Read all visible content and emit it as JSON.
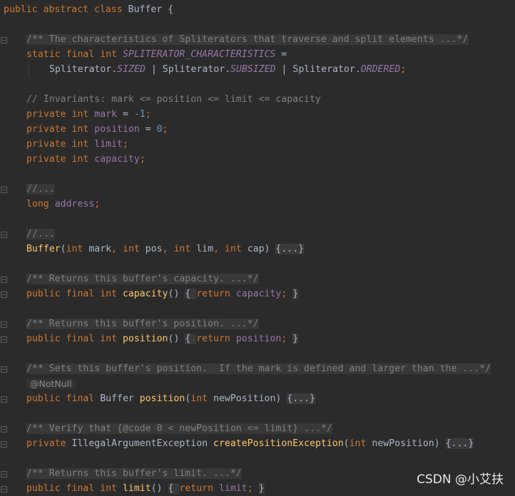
{
  "editor": {
    "colors": {
      "background": "#2b2b2b",
      "keyword": "#cc7832",
      "field": "#9876aa",
      "method": "#ffc66d",
      "number": "#6897bb",
      "comment": "#808080"
    },
    "lines": [
      {
        "fold": false,
        "indent": 0,
        "tokens": [
          [
            "kw",
            "public abstract class "
          ],
          [
            "pl",
            "Buffer {"
          ]
        ]
      },
      {
        "blank": true
      },
      {
        "fold": true,
        "indent": 4,
        "tokens": [
          [
            "doc",
            "/** The characteristics of Spliterators that traverse and split elements ...*/"
          ]
        ]
      },
      {
        "fold": false,
        "indent": 4,
        "tokens": [
          [
            "kw",
            "static final int "
          ],
          [
            "fldi",
            "SPLITERATOR_CHARACTERISTICS"
          ],
          [
            "pl",
            " ="
          ]
        ]
      },
      {
        "fold": false,
        "indent": 8,
        "tokens": [
          [
            "pl",
            "Spliterator."
          ],
          [
            "fldi",
            "SIZED"
          ],
          [
            "pl",
            " | Spliterator."
          ],
          [
            "fldi",
            "SUBSIZED"
          ],
          [
            "pl",
            " | Spliterator."
          ],
          [
            "fldi",
            "ORDERED"
          ],
          [
            "kw",
            ";"
          ]
        ]
      },
      {
        "blank": true
      },
      {
        "fold": false,
        "indent": 4,
        "tokens": [
          [
            "cmt",
            "// Invariants: mark <= position <= limit <= capacity"
          ]
        ]
      },
      {
        "fold": false,
        "indent": 4,
        "tokens": [
          [
            "kw",
            "private int "
          ],
          [
            "fld",
            "mark"
          ],
          [
            "pl",
            " = "
          ],
          [
            "num",
            "-1"
          ],
          [
            "kw",
            ";"
          ]
        ]
      },
      {
        "fold": false,
        "indent": 4,
        "tokens": [
          [
            "kw",
            "private int "
          ],
          [
            "fld",
            "position"
          ],
          [
            "pl",
            " = "
          ],
          [
            "num",
            "0"
          ],
          [
            "kw",
            ";"
          ]
        ]
      },
      {
        "fold": false,
        "indent": 4,
        "tokens": [
          [
            "kw",
            "private int "
          ],
          [
            "fld",
            "limit"
          ],
          [
            "kw",
            ";"
          ]
        ]
      },
      {
        "fold": false,
        "indent": 4,
        "tokens": [
          [
            "kw",
            "private int "
          ],
          [
            "fld",
            "capacity"
          ],
          [
            "kw",
            ";"
          ]
        ]
      },
      {
        "blank": true
      },
      {
        "fold": true,
        "indent": 4,
        "tokens": [
          [
            "doc",
            "//..."
          ]
        ]
      },
      {
        "fold": false,
        "indent": 4,
        "tokens": [
          [
            "kw",
            "long "
          ],
          [
            "fld",
            "address"
          ],
          [
            "kw",
            ";"
          ]
        ]
      },
      {
        "blank": true
      },
      {
        "fold": true,
        "indent": 4,
        "tokens": [
          [
            "doc",
            "//..."
          ]
        ]
      },
      {
        "fold": false,
        "indent": 4,
        "tokens": [
          [
            "mth",
            "Buffer"
          ],
          [
            "pl",
            "("
          ],
          [
            "kw",
            "int "
          ],
          [
            "pl",
            "mark"
          ],
          [
            "kw",
            ", int "
          ],
          [
            "pl",
            "pos"
          ],
          [
            "kw",
            ", int "
          ],
          [
            "pl",
            "lim"
          ],
          [
            "kw",
            ", int "
          ],
          [
            "pl",
            "cap) "
          ],
          [
            "fb",
            "{...}"
          ]
        ]
      },
      {
        "blank": true
      },
      {
        "fold": true,
        "indent": 4,
        "tokens": [
          [
            "doc",
            "/** Returns this buffer's capacity. ...*/"
          ]
        ]
      },
      {
        "fold": true,
        "indent": 4,
        "tokens": [
          [
            "kw",
            "public final int "
          ],
          [
            "mth",
            "capacity"
          ],
          [
            "pl",
            "() "
          ],
          [
            "fb",
            "{ "
          ],
          [
            "kw",
            "return "
          ],
          [
            "fld",
            "capacity"
          ],
          [
            "kw",
            ";"
          ],
          [
            "pl",
            " "
          ],
          [
            "fb",
            "}"
          ]
        ]
      },
      {
        "blank": true
      },
      {
        "fold": true,
        "indent": 4,
        "tokens": [
          [
            "doc",
            "/** Returns this buffer's position. ...*/"
          ]
        ]
      },
      {
        "fold": true,
        "indent": 4,
        "tokens": [
          [
            "kw",
            "public final int "
          ],
          [
            "mth",
            "position"
          ],
          [
            "pl",
            "() "
          ],
          [
            "fb",
            "{ "
          ],
          [
            "kw",
            "return "
          ],
          [
            "fld",
            "position"
          ],
          [
            "kw",
            ";"
          ],
          [
            "pl",
            " "
          ],
          [
            "fb",
            "}"
          ]
        ]
      },
      {
        "blank": true
      },
      {
        "fold": true,
        "indent": 4,
        "tokens": [
          [
            "doc",
            "/** Sets this buffer's position.  If the mark is defined and larger than the ...*/"
          ]
        ]
      },
      {
        "fold": false,
        "indent": 4,
        "tokens": [
          [
            "ann",
            "@NotNull"
          ]
        ]
      },
      {
        "fold": true,
        "indent": 4,
        "tokens": [
          [
            "kw",
            "public final "
          ],
          [
            "pl",
            "Buffer "
          ],
          [
            "mth",
            "position"
          ],
          [
            "pl",
            "("
          ],
          [
            "kw",
            "int "
          ],
          [
            "pl",
            "newPosition) "
          ],
          [
            "fb",
            "{...}"
          ]
        ]
      },
      {
        "blank": true
      },
      {
        "fold": true,
        "indent": 4,
        "tokens": [
          [
            "doc",
            "/** Verify that {@code 0 < newPosition <= limit} ...*/"
          ]
        ]
      },
      {
        "fold": true,
        "indent": 4,
        "tokens": [
          [
            "kw",
            "private "
          ],
          [
            "pl",
            "IllegalArgumentException "
          ],
          [
            "mth",
            "createPositionException"
          ],
          [
            "pl",
            "("
          ],
          [
            "kw",
            "int "
          ],
          [
            "pl",
            "newPosition) "
          ],
          [
            "fb",
            "{...}"
          ]
        ]
      },
      {
        "blank": true
      },
      {
        "fold": true,
        "indent": 4,
        "tokens": [
          [
            "doc",
            "/** Returns this buffer's limit. ...*/"
          ]
        ]
      },
      {
        "fold": true,
        "indent": 4,
        "tokens": [
          [
            "kw",
            "public final int "
          ],
          [
            "mth",
            "limit"
          ],
          [
            "pl",
            "() "
          ],
          [
            "fb",
            "{ "
          ],
          [
            "kw",
            "return "
          ],
          [
            "fld",
            "limit"
          ],
          [
            "kw",
            ";"
          ],
          [
            "pl",
            " "
          ],
          [
            "fb",
            "}"
          ]
        ]
      }
    ]
  },
  "watermark": "CSDN @小艾扶"
}
